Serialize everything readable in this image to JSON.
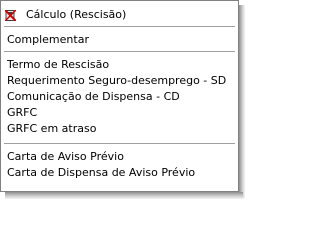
{
  "menu": {
    "header_item": {
      "label": "Cálculo (Rescisão)",
      "icon": "calculator-strike-icon"
    },
    "group1": [
      {
        "label": "Complementar"
      }
    ],
    "group2": [
      {
        "label": "Termo de Rescisão"
      },
      {
        "label": "Requerimento Seguro-desemprego - SD"
      },
      {
        "label": "Comunicação de Dispensa - CD"
      },
      {
        "label": "GRFC"
      },
      {
        "label": "GRFC em atraso"
      }
    ],
    "group3": [
      {
        "label": "Carta de Aviso Prévio"
      },
      {
        "label": "Carta de Dispensa de Aviso Prévio"
      }
    ]
  },
  "colors": {
    "border": "#808080",
    "icon_red": "#cc0000",
    "separator": "#a0a0a0"
  }
}
